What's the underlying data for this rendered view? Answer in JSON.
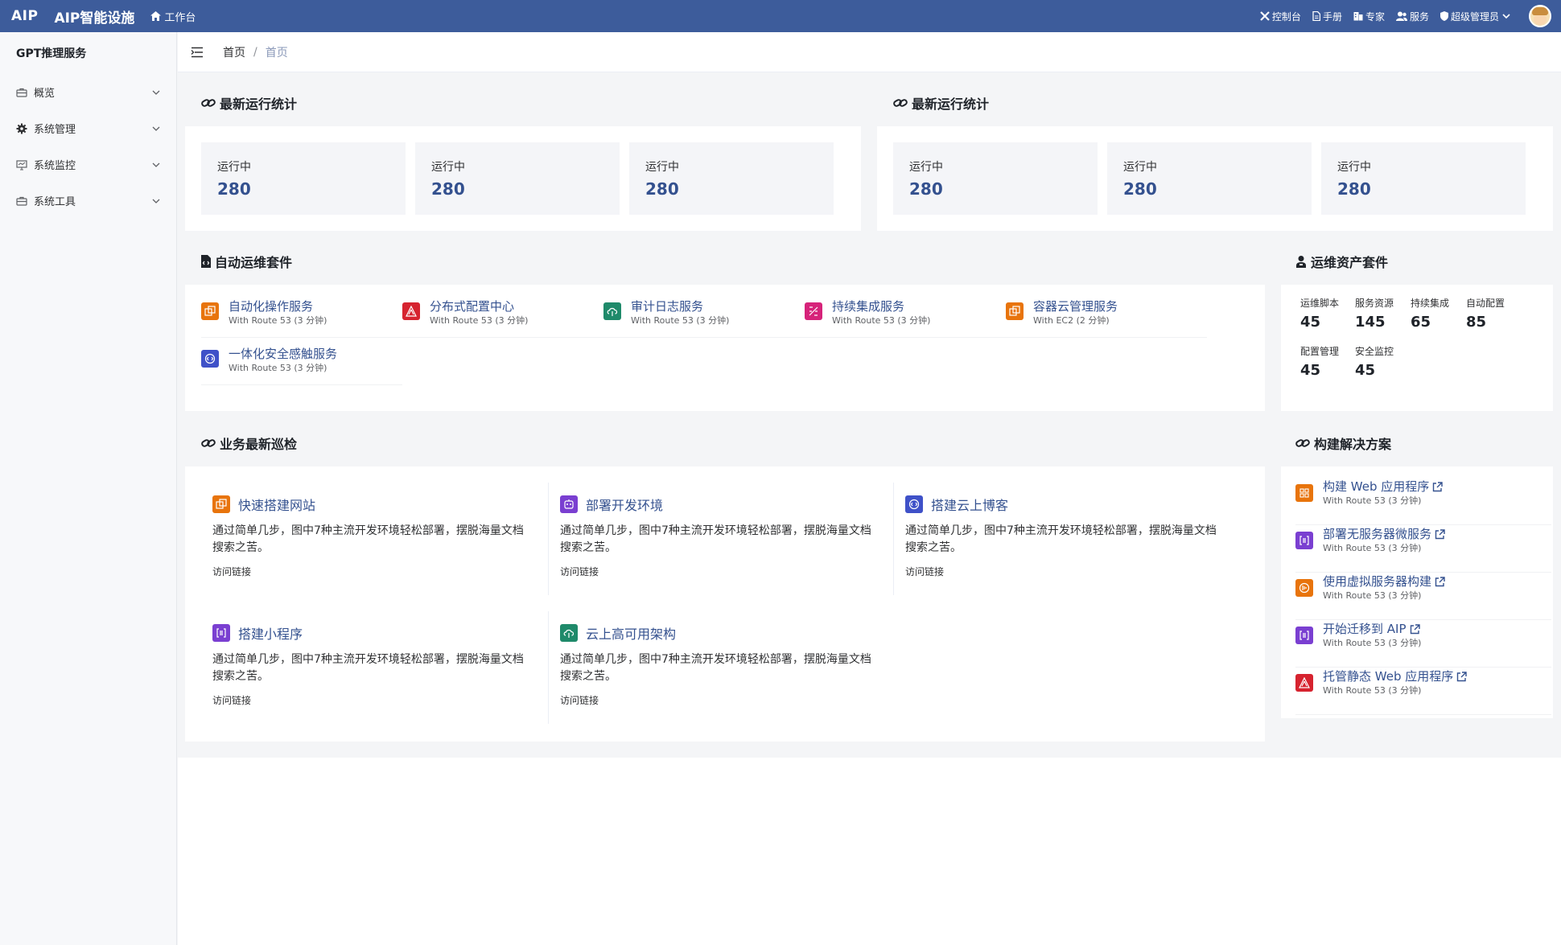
{
  "header": {
    "brand": "AIP",
    "app_name": "AIP智能设施",
    "workbench": "工作台",
    "nav": [
      {
        "label": "控制台",
        "icon": "tools-icon"
      },
      {
        "label": "手册",
        "icon": "document-icon"
      },
      {
        "label": "专家",
        "icon": "building-icon"
      },
      {
        "label": "服务",
        "icon": "users-icon"
      }
    ],
    "user": "超级管理员"
  },
  "sidebar": {
    "title": "GPT推理服务",
    "items": [
      {
        "label": "概览"
      },
      {
        "label": "系统管理"
      },
      {
        "label": "系统监控"
      },
      {
        "label": "系统工具"
      }
    ]
  },
  "breadcrumb": {
    "home": "首页",
    "separator": "/",
    "current": "首页"
  },
  "stats_left": {
    "title": "最新运行统计",
    "items": [
      {
        "label": "运行中",
        "value": "280"
      },
      {
        "label": "运行中",
        "value": "280"
      },
      {
        "label": "运行中",
        "value": "280"
      }
    ]
  },
  "stats_right": {
    "title": "最新运行统计",
    "items": [
      {
        "label": "运行中",
        "value": "280"
      },
      {
        "label": "运行中",
        "value": "280"
      },
      {
        "label": "运行中",
        "value": "280"
      }
    ]
  },
  "auto_ops": {
    "title": "自动运维套件",
    "items": [
      {
        "name": "自动化操作服务",
        "sub": "With Route 53 (3 分钟)",
        "color": "#e8740c"
      },
      {
        "name": "分布式配置中心",
        "sub": "With Route 53 (3 分钟)",
        "color": "#d6232f"
      },
      {
        "name": "审计日志服务",
        "sub": "With Route 53 (3 分钟)",
        "color": "#1f8a6a"
      },
      {
        "name": "持续集成服务",
        "sub": "With Route 53 (3 分钟)",
        "color": "#d6237a"
      },
      {
        "name": "容器云管理服务",
        "sub": "With EC2 (2 分钟)",
        "color": "#e8740c"
      },
      {
        "name": "一体化安全感触服务",
        "sub": "With Route 53 (3 分钟)",
        "color": "#3f51c8"
      }
    ]
  },
  "assets": {
    "title": "运维资产套件",
    "items": [
      {
        "label": "运维脚本",
        "value": "45"
      },
      {
        "label": "服务资源",
        "value": "145"
      },
      {
        "label": "持续集成",
        "value": "65"
      },
      {
        "label": "自动配置",
        "value": "85"
      },
      {
        "label": "配置管理",
        "value": "45"
      },
      {
        "label": "安全监控",
        "value": "45"
      }
    ]
  },
  "patrol": {
    "title": "业务最新巡检",
    "items": [
      {
        "name": "快速搭建网站",
        "desc": "通过简单几步，图中7种主流开发环境轻松部署，摆脱海量文档搜索之苦。",
        "link": "访问链接",
        "color": "#e8740c"
      },
      {
        "name": "部署开发环境",
        "desc": "通过简单几步，图中7种主流开发环境轻松部署，摆脱海量文档搜索之苦。",
        "link": "访问链接",
        "color": "#7a3fd1"
      },
      {
        "name": "搭建云上博客",
        "desc": "通过简单几步，图中7种主流开发环境轻松部署，摆脱海量文档搜索之苦。",
        "link": "访问链接",
        "color": "#3f51c8"
      },
      {
        "name": "搭建小程序",
        "desc": "通过简单几步，图中7种主流开发环境轻松部署，摆脱海量文档搜索之苦。",
        "link": "访问链接",
        "color": "#7a3fd1"
      },
      {
        "name": "云上高可用架构",
        "desc": "通过简单几步，图中7种主流开发环境轻松部署，摆脱海量文档搜索之苦。",
        "link": "访问链接",
        "color": "#1f8a6a"
      }
    ]
  },
  "solutions": {
    "title": "构建解决方案",
    "items": [
      {
        "name": "构建 Web 应用程序",
        "sub": "With Route 53 (3 分钟)",
        "color": "#e8740c"
      },
      {
        "name": "部署无服务器微服务",
        "sub": "With Route 53 (3 分钟)",
        "color": "#7a3fd1"
      },
      {
        "name": "使用虚拟服务器构建",
        "sub": "With Route 53 (3 分钟)",
        "color": "#e8740c"
      },
      {
        "name": "开始迁移到 AIP",
        "sub": "With Route 53 (3 分钟)",
        "color": "#7a3fd1"
      },
      {
        "name": "托管静态 Web 应用程序",
        "sub": "With Route 53 (3 分钟)",
        "color": "#d6232f"
      }
    ]
  }
}
